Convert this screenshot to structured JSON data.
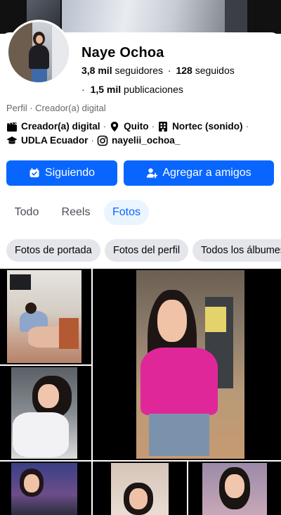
{
  "profile": {
    "name": "Naye Ochoa",
    "followers_count": "3,8 mil",
    "followers_label": "seguidores",
    "dot": "·",
    "following_count": "128",
    "following_label": "seguidos",
    "posts_prefix": "·",
    "posts_count": "1,5 mil",
    "posts_label": "publicaciones",
    "subtitle": "Perfil · Creador(a) digital"
  },
  "details": [
    {
      "icon": "clapperboard-icon",
      "text": "Creador(a) digital"
    },
    {
      "icon": "location-pin-icon",
      "text": "Quito"
    },
    {
      "icon": "building-icon",
      "text": "Nortec (sonido)"
    },
    {
      "icon": "graduation-cap-icon",
      "text": "UDLA Ecuador"
    },
    {
      "icon": "instagram-icon",
      "text": "nayelii_ochoa_"
    }
  ],
  "buttons": {
    "following": "Siguiendo",
    "add_friend": "Agregar a amigos"
  },
  "tabs": [
    {
      "label": "Todo",
      "active": false
    },
    {
      "label": "Reels",
      "active": false
    },
    {
      "label": "Fotos",
      "active": true
    }
  ],
  "chips": [
    "Fotos de portada",
    "Fotos del perfil",
    "Todos los álbumes"
  ],
  "colors": {
    "accent": "#0866ff",
    "accent_light": "#ebf5ff",
    "chip_bg": "#e4e6eb",
    "secondary_text": "#65676b"
  }
}
